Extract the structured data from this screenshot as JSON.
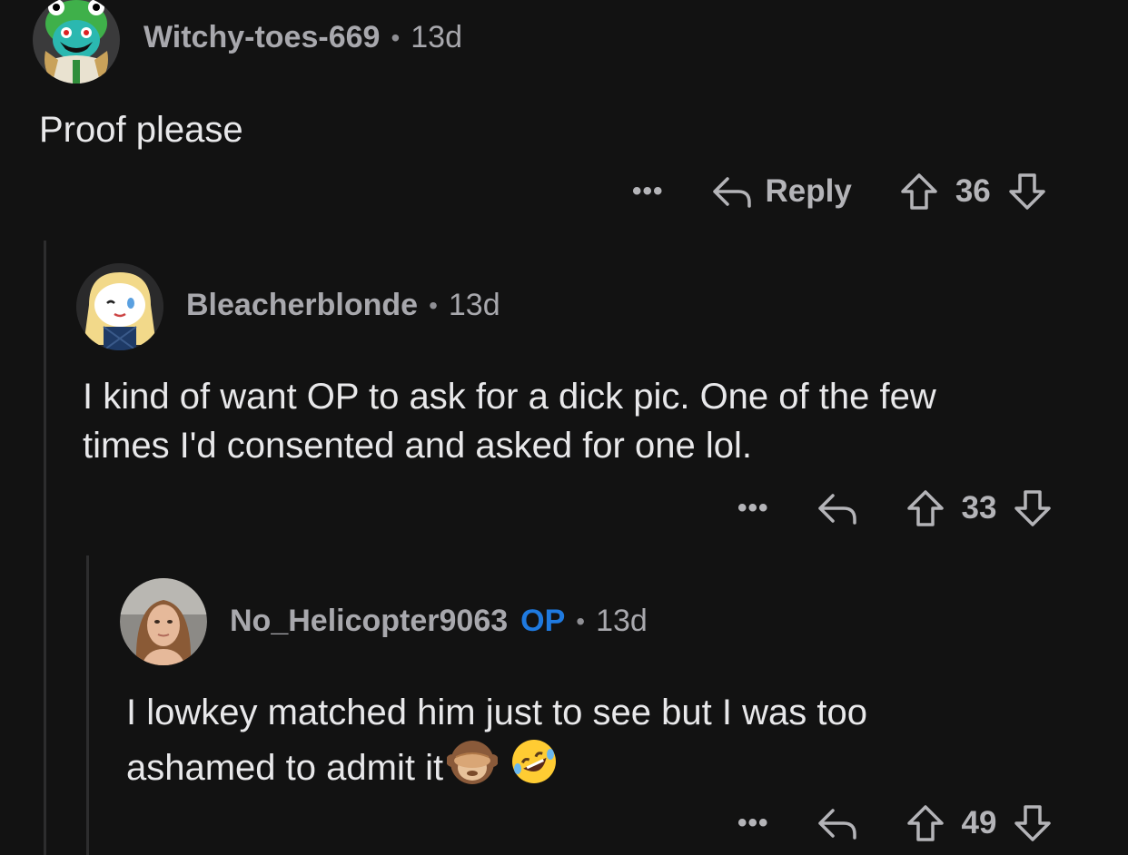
{
  "comments": [
    {
      "username": "Witchy-toes-669",
      "is_op": false,
      "time": "13d",
      "body": "Proof please",
      "reply_label": "Reply",
      "more_label": "•••",
      "score": "36",
      "avatar_icon": "snoo-frog-avatar"
    },
    {
      "username": "Bleacherblonde",
      "is_op": false,
      "time": "13d",
      "body_lines": [
        "I kind of want OP to ask for a dick pic. One of the few",
        "times I'd consented and asked for one lol."
      ],
      "more_label": "•••",
      "score": "33",
      "avatar_icon": "snoo-blonde-avatar"
    },
    {
      "username": "No_Helicopter9063",
      "op_badge": "OP",
      "is_op": true,
      "time": "13d",
      "body_lines": [
        "I lowkey matched him just to see but I was too",
        "ashamed to admit it"
      ],
      "emojis": [
        "see-no-evil-monkey-emoji",
        "rolling-on-floor-laughing-emoji"
      ],
      "more_label": "•••",
      "score": "49",
      "avatar_icon": "profile-photo-avatar"
    }
  ],
  "separator": "•",
  "colors": {
    "background": "#121212",
    "text": "#e8e8ea",
    "meta": "#a8a8ad",
    "op_badge": "#1f7ae0",
    "thread_line": "#2d2d2e"
  }
}
